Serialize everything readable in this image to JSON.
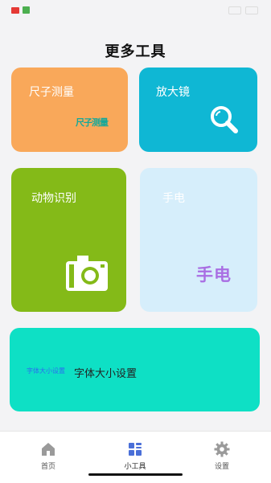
{
  "status": {
    "time": "",
    "carrier_badge": "",
    "app_icon": "house-icon"
  },
  "page": {
    "title": "更多工具"
  },
  "cards": {
    "ruler": {
      "label": "尺子测量",
      "logo_text": "尺子测量",
      "color": "#f9a85a",
      "icon": "ruler-logo"
    },
    "magnifier": {
      "label": "放大镜",
      "color": "#0fb7d4",
      "icon": "magnifier-icon"
    },
    "animal": {
      "label": "动物识别",
      "color": "#84ba18",
      "icon": "camera-icon"
    },
    "flashlight": {
      "label": "手电",
      "logo_text": "手电",
      "color": "#d6eefb",
      "text_color": "#a96ee3"
    },
    "font": {
      "label": "字体大小设置",
      "logo_text": "字体大小设置",
      "color": "#0ee0c5"
    }
  },
  "nav": {
    "items": [
      {
        "label": "首页",
        "icon": "home-icon"
      },
      {
        "label": "小工具",
        "icon": "tools-icon",
        "active": true
      },
      {
        "label": "设置",
        "icon": "gear-icon"
      }
    ],
    "active_color": "#4a6fd8"
  }
}
